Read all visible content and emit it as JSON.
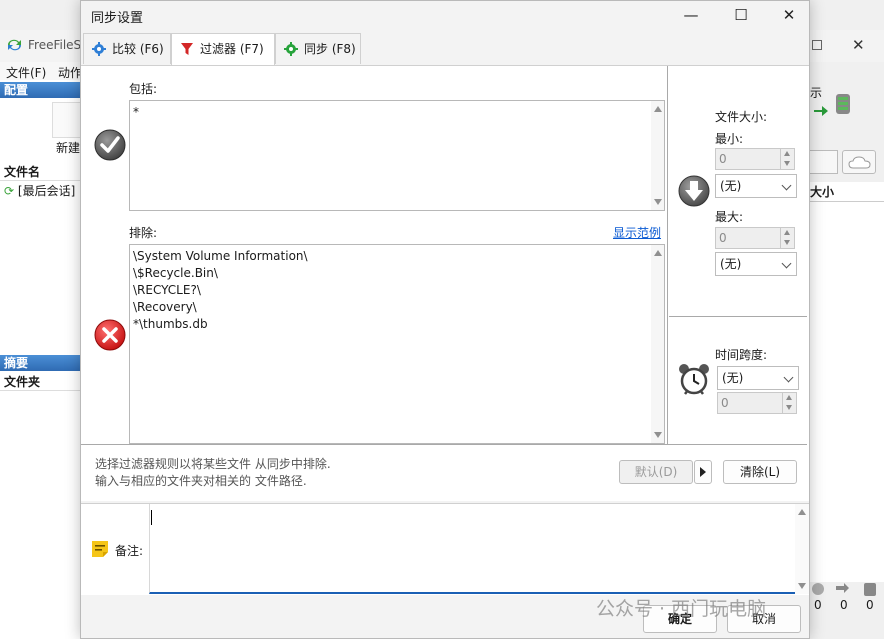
{
  "background": {
    "app_title": "FreeFileSy",
    "menu": [
      "文件(F)",
      "动作"
    ],
    "config_header": "配置",
    "new_label": "新建",
    "filename_header": "文件名",
    "last_session": "[最后会话]",
    "summary_header": "摘要",
    "folder_header": "文件夹",
    "right_fragment": "示",
    "right_size_header": "大小",
    "counts": [
      "0",
      "0",
      "0"
    ]
  },
  "dialog": {
    "title": "同步设置",
    "tabs": [
      {
        "label": "比较 (F6)",
        "icon": "gear-icon"
      },
      {
        "label": "过滤器 (F7)",
        "icon": "filter-icon"
      },
      {
        "label": "同步 (F8)",
        "icon": "gear-green-icon"
      }
    ],
    "include": {
      "label": "包括:",
      "value": "*"
    },
    "exclude": {
      "label": "排除:",
      "link": "显示范例",
      "lines": [
        "\\System Volume Information\\",
        "\\$Recycle.Bin\\",
        "\\RECYCLE?\\",
        "\\Recovery\\",
        "*\\thumbs.db"
      ]
    },
    "filesize": {
      "label": "文件大小:",
      "min_label": "最小:",
      "min_value": "0",
      "min_unit": "(无)",
      "max_label": "最大:",
      "max_value": "0",
      "max_unit": "(无)"
    },
    "timespan": {
      "label": "时间跨度:",
      "unit": "(无)",
      "value": "0"
    },
    "footer": {
      "line1": "选择过滤器规则以将某些文件 从同步中排除.",
      "line2": "输入与相应的文件夹对相关的 文件路径.",
      "default_btn": "默认(D)",
      "clear_btn": "清除(L)"
    },
    "notes_label": "备注:",
    "ok_btn": "确定",
    "cancel_btn": "取消"
  },
  "watermark": "公众号 · 西门玩电脑"
}
